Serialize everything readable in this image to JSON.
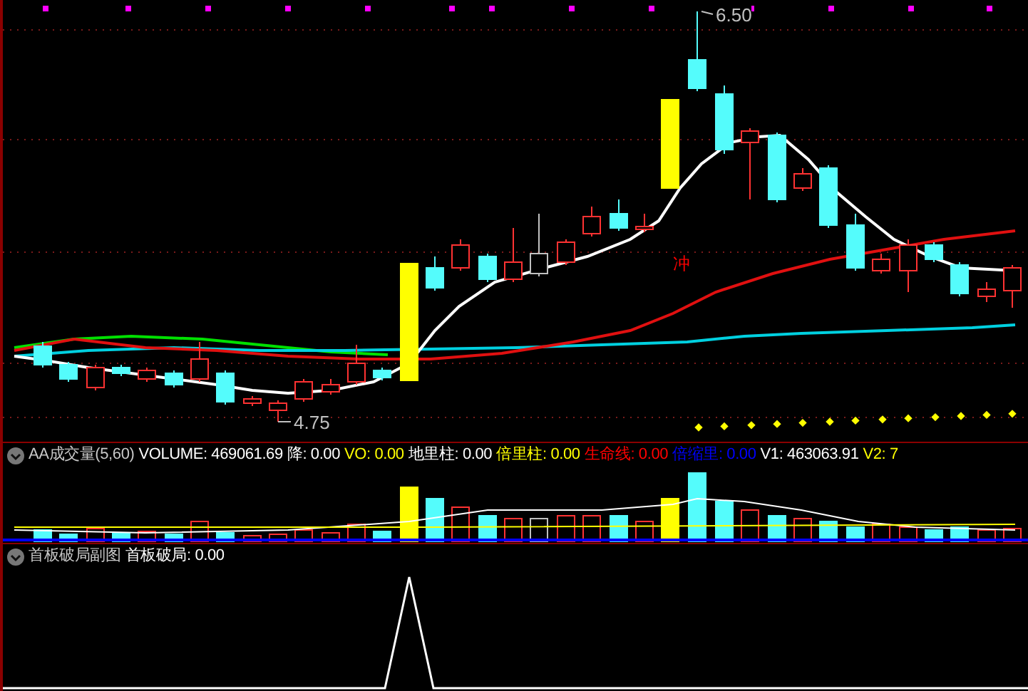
{
  "main_chart": {
    "high_label": "6.50",
    "low_label": "4.75",
    "signal_label": "冲"
  },
  "volume_panel": {
    "title": "AA成交量(5,60)",
    "legend": [
      {
        "label": "VOLUME: 469061.69",
        "color": "#ffffff"
      },
      {
        "label": "降: 0.00",
        "color": "#ffffff"
      },
      {
        "label": "VO: 0.00",
        "color": "#ffff00"
      },
      {
        "label": "地里柱: 0.00",
        "color": "#ffffff"
      },
      {
        "label": "倍里柱: 0.00",
        "color": "#ffff00"
      },
      {
        "label": "生命线: 0.00",
        "color": "#ff0000"
      },
      {
        "label": "倍缩里: 0.00",
        "color": "#0000ff"
      },
      {
        "label": "V1: 463063.91",
        "color": "#ffffff"
      },
      {
        "label": "V2: 7",
        "color": "#ffff00"
      }
    ]
  },
  "sub_panel": {
    "title": "首板破局副图",
    "legend": [
      {
        "label": "首板破局: 0.00",
        "color": "#ffffff"
      }
    ]
  }
}
